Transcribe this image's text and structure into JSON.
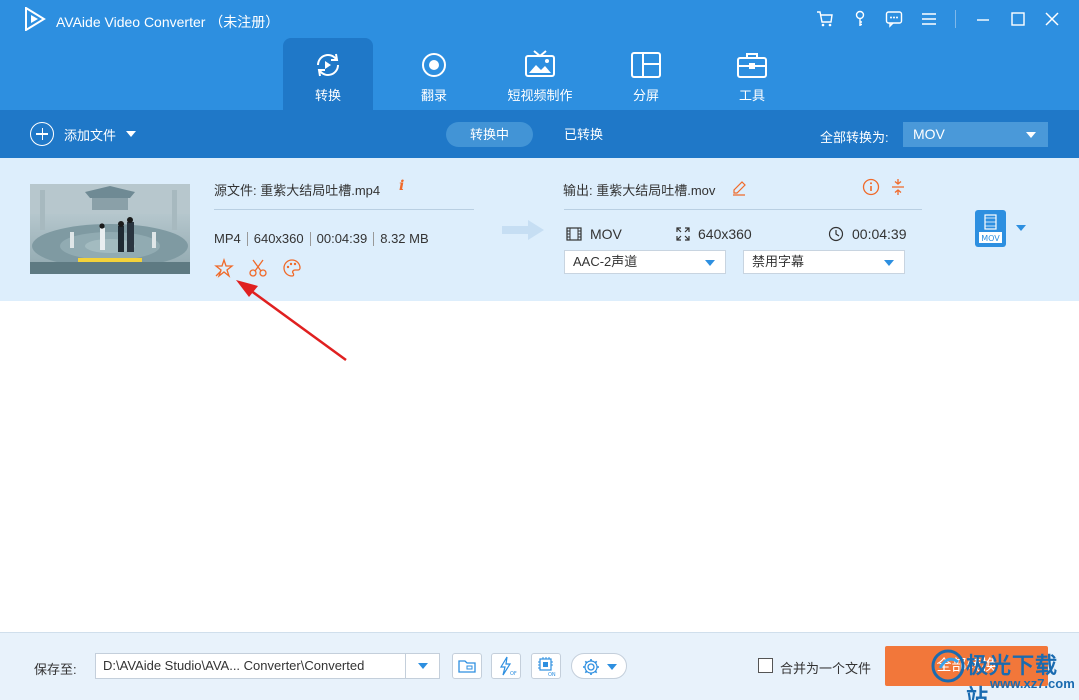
{
  "window": {
    "title": "AVAide Video Converter （未注册）"
  },
  "nav": {
    "tabs": [
      {
        "label": "转换",
        "icon": "convert-icon",
        "active": true
      },
      {
        "label": "翻录",
        "icon": "record-icon",
        "active": false
      },
      {
        "label": "短视频制作",
        "icon": "mv-icon",
        "active": false
      },
      {
        "label": "分屏",
        "icon": "collage-icon",
        "active": false
      },
      {
        "label": "工具",
        "icon": "toolbox-icon",
        "active": false
      }
    ]
  },
  "toolbar": {
    "add_file_label": "添加文件",
    "tabs": {
      "converting": "转换中",
      "converted": "已转换"
    },
    "convert_all_label": "全部转换为:",
    "convert_all_format": "MOV"
  },
  "file": {
    "source_label": "源文件: 重紫大结局吐槽.mp4",
    "format": "MP4",
    "resolution": "640x360",
    "duration": "00:04:39",
    "size": "8.32 MB",
    "output_label": "输出: 重紫大结局吐槽.mov",
    "output_format": "MOV",
    "output_resolution": "640x360",
    "output_duration": "00:04:39",
    "audio_track": "AAC-2声道",
    "subtitle": "禁用字幕",
    "format_badge": "MOV"
  },
  "bottom": {
    "save_label": "保存至:",
    "save_path": "D:\\AVAide Studio\\AVA... Converter\\Converted",
    "merge_label": "合并为一个文件",
    "convert_all_button": "全部转换"
  },
  "watermark": {
    "text": "极光下载站",
    "url": "www.xz7.com"
  },
  "colors": {
    "header": "#2d8fe0",
    "toolbar": "#1f78c8",
    "row_bg": "#ddeefc",
    "accent": "#f2773a",
    "annotation_arrow": "#e02020"
  }
}
